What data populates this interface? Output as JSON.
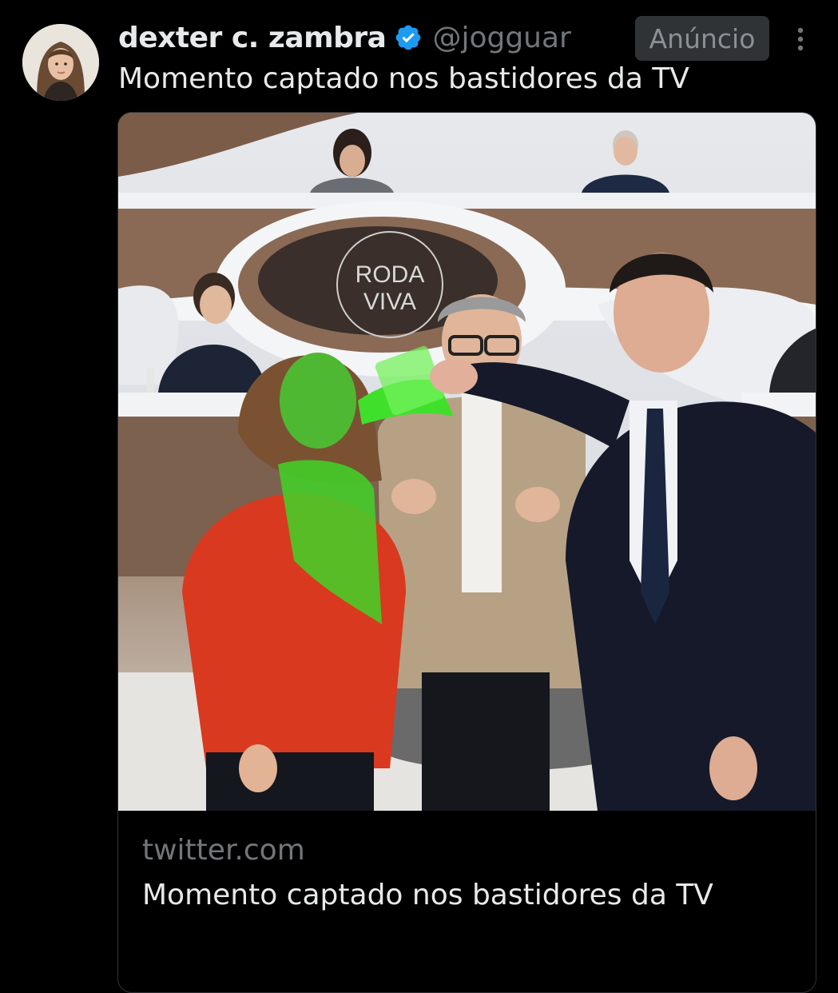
{
  "tweet": {
    "author": {
      "display_name": "dexter c. zambra",
      "handle": "@jogguar",
      "verified": true
    },
    "ad_label": "Anúncio",
    "text": "Momento captado nos bastidores da TV",
    "more_icon": "more-vertical-icon"
  },
  "card": {
    "image_logo_text": [
      "RODA",
      "VIVA"
    ],
    "domain": "twitter.com",
    "title": "Momento captado nos bastidores da TV"
  },
  "colors": {
    "background": "#000000",
    "text_primary": "#e7e9ea",
    "text_secondary": "#71767b",
    "verified_blue": "#1d9bf0",
    "border": "#2f3336"
  }
}
